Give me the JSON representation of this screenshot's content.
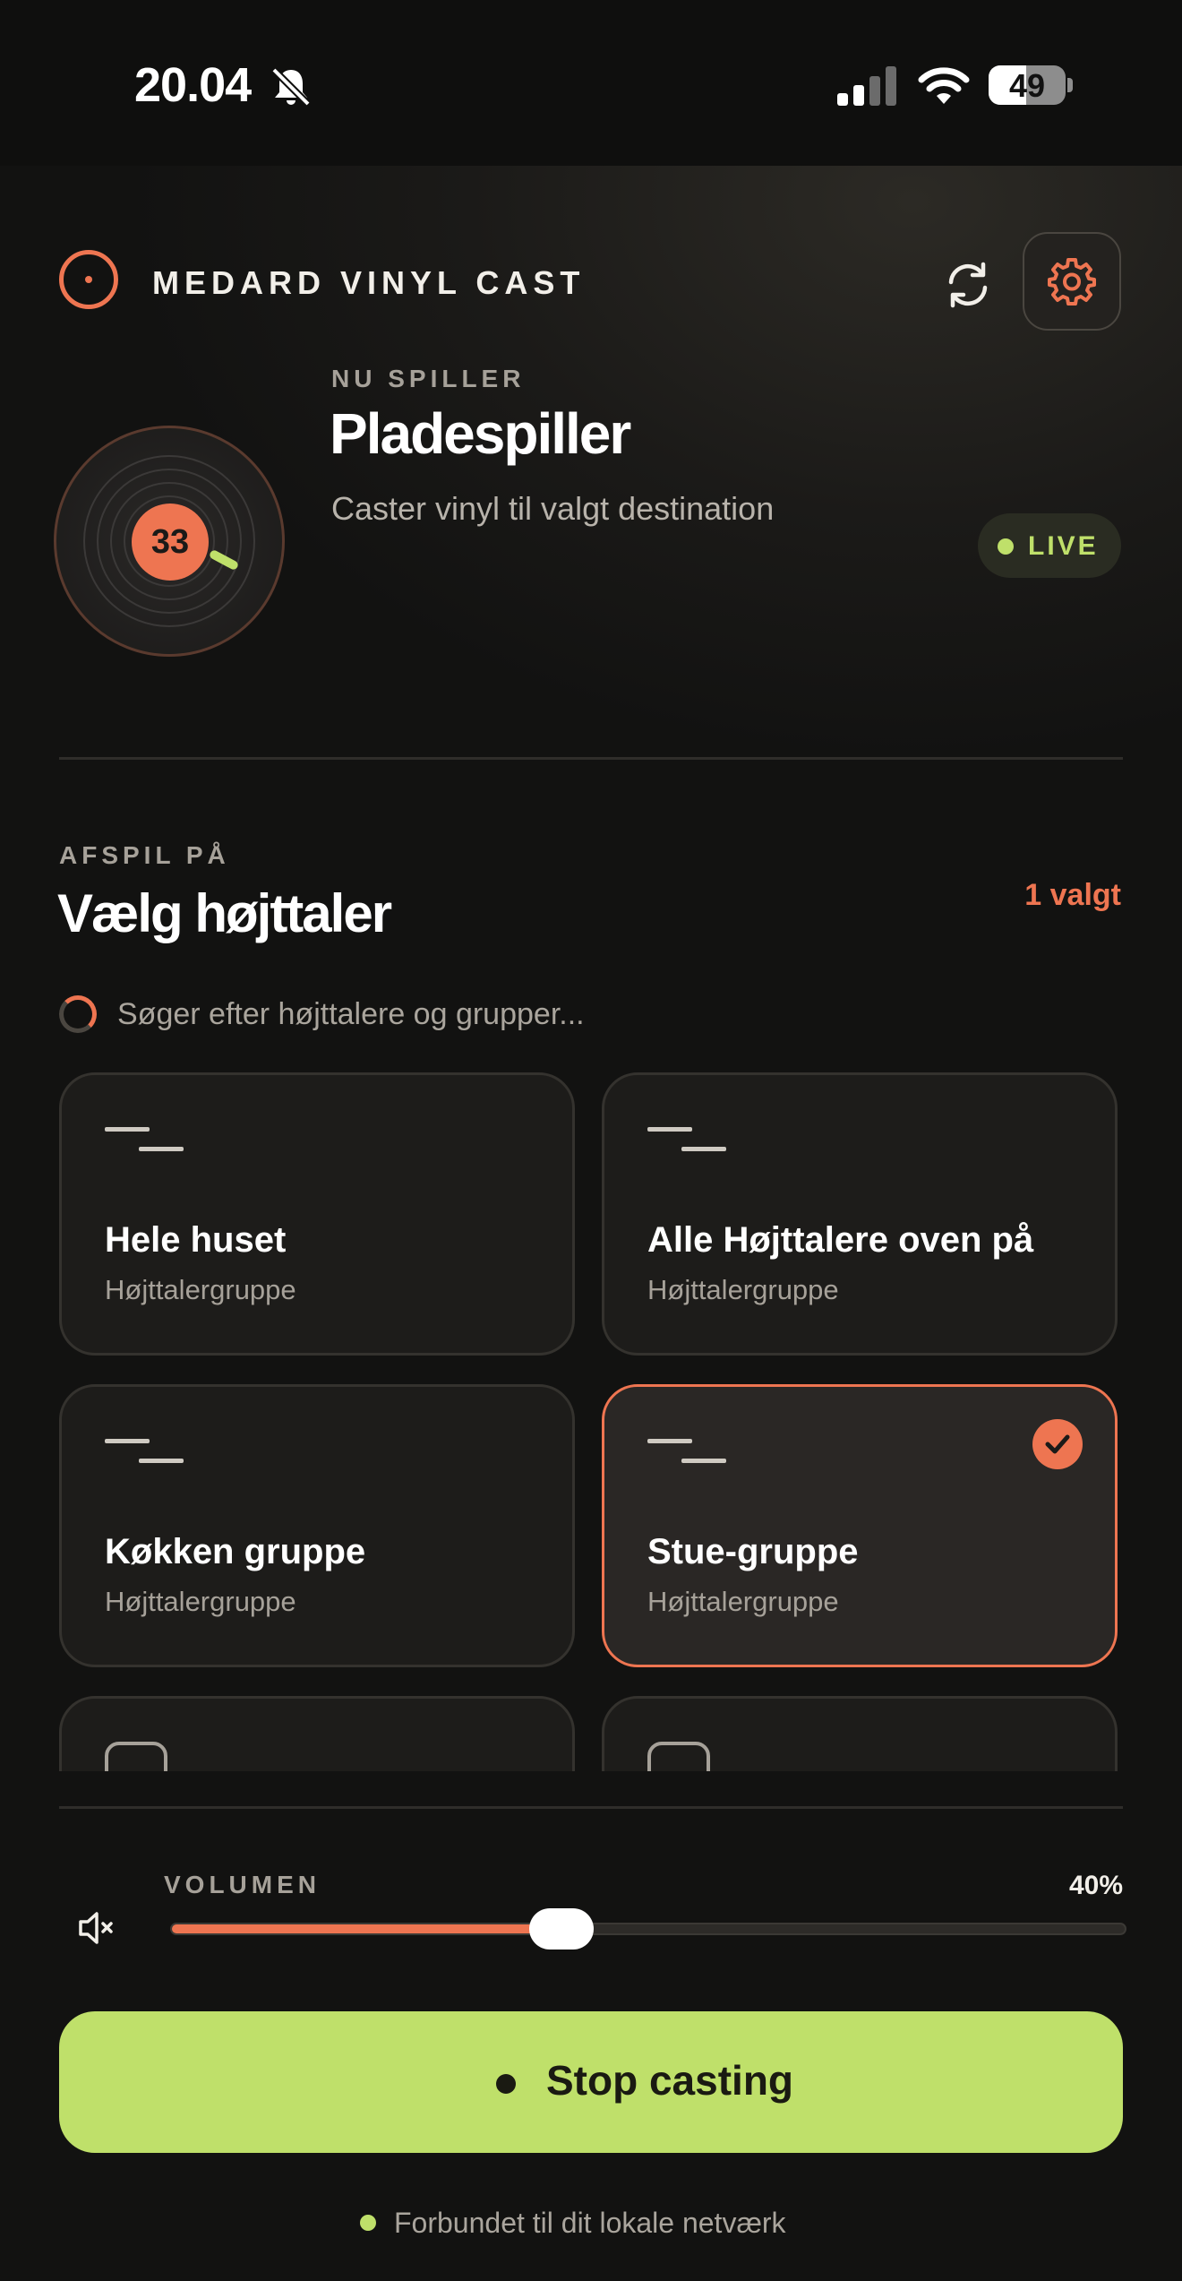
{
  "status_bar": {
    "time": "20.04",
    "battery_level": "49",
    "icons": [
      "bell-slash-icon",
      "cellular-signal-icon",
      "wifi-icon",
      "battery-icon"
    ]
  },
  "header": {
    "brand": "MEDARD VINYL CAST",
    "icons": [
      "record-logo-icon",
      "refresh-icon",
      "gear-icon"
    ],
    "accent_color": "#ee7551"
  },
  "now_playing": {
    "kicker": "NU SPILLER",
    "title": "Pladespiller",
    "subtitle": "Caster vinyl til valgt destination",
    "record_label": "33",
    "live_badge": "LIVE",
    "live_color": "#bfe06a"
  },
  "speakers": {
    "kicker": "AFSPIL PÅ",
    "title": "Vælg højttaler",
    "selected_count": "1 valgt",
    "searching_text": "Søger efter højttalere og grupper...",
    "items": [
      {
        "name": "Hele huset",
        "type": "Højttalergruppe",
        "selected": false
      },
      {
        "name": "Alle Højttalere oven på",
        "type": "Højttalergruppe",
        "selected": false
      },
      {
        "name": "Køkken gruppe",
        "type": "Højttalergruppe",
        "selected": false
      },
      {
        "name": "Stue-gruppe",
        "type": "Højttalergruppe",
        "selected": true
      }
    ]
  },
  "volume": {
    "label": "VOLUMEN",
    "value_text": "40%",
    "level": 0.4,
    "icon": "speaker-mute-icon"
  },
  "primary_action": {
    "label": "Stop casting"
  },
  "footer": {
    "network_status": "Forbundet til dit lokale netværk"
  }
}
